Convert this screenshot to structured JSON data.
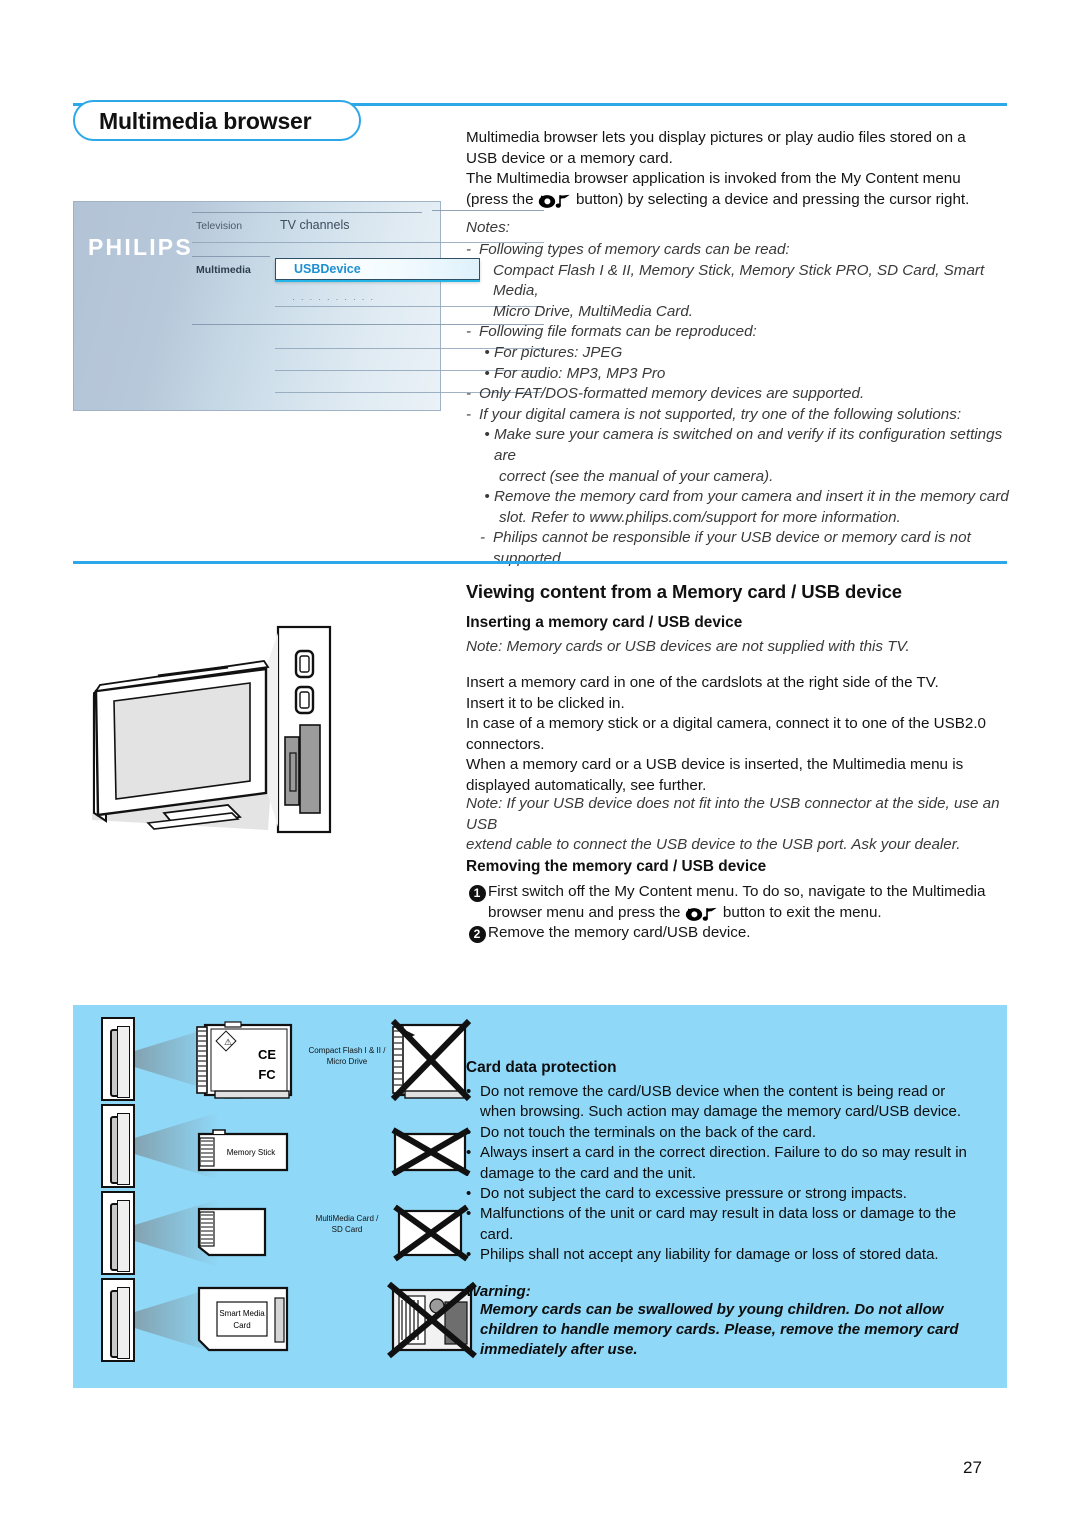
{
  "page": {
    "number": "27"
  },
  "title": {
    "text": "Multimedia browser"
  },
  "colors": {
    "accent": "#2CA8E8",
    "panel": "#8FD8F8",
    "menu_highlight": "#1e8fd0"
  },
  "tv_menu": {
    "brand": "PHILIPS",
    "col_left": [
      "Television",
      "Multimedia"
    ],
    "col_right_top": "TV channels",
    "selected_item": "USBDevice",
    "placeholder_dots": "· · · · · · · · · ·"
  },
  "intro": {
    "lines": [
      "Multimedia browser lets you display pictures or play audio files stored on a",
      "USB device or a memory card.",
      "The Multimedia browser application is invoked from the My Content menu",
      "(press the ",
      " button) by selecting a device and pressing the cursor right."
    ]
  },
  "notes": {
    "heading": "Notes:",
    "items": [
      {
        "marker": "-",
        "indent": 0,
        "text": "Following types of memory cards can be read:"
      },
      {
        "marker": "",
        "indent": 1,
        "text": "Compact Flash I & II, Memory Stick, Memory Stick PRO, SD Card, Smart Media,"
      },
      {
        "marker": "",
        "indent": 1,
        "text": "Micro Drive, MultiMedia Card."
      },
      {
        "marker": "-",
        "indent": 0,
        "text": "Following file formats can be reproduced:"
      },
      {
        "marker": "•",
        "indent": 1,
        "text": "For pictures: JPEG"
      },
      {
        "marker": "•",
        "indent": 1,
        "text": "For audio: MP3, MP3 Pro"
      },
      {
        "marker": "-",
        "indent": 0,
        "text": "Only FAT/DOS-formatted memory devices are supported."
      },
      {
        "marker": "-",
        "indent": 0,
        "text": "If your digital camera is not supported, try one of the following solutions:"
      },
      {
        "marker": "•",
        "indent": 1,
        "text": "Make sure your camera is switched on and verify if its configuration settings are"
      },
      {
        "marker": "",
        "indent": 2,
        "text": "correct (see the manual of your camera)."
      },
      {
        "marker": "•",
        "indent": 1,
        "text": "Remove the memory card from your camera and insert it in the memory card"
      },
      {
        "marker": "",
        "indent": 2,
        "text": "slot. Refer to www.philips.com/support for more information."
      },
      {
        "marker": "-",
        "indent": 1,
        "text": "Philips cannot be responsible if your USB device or memory card is not supported."
      }
    ]
  },
  "section": {
    "heading": "Viewing content from a Memory card / USB device",
    "sub_insert": "Inserting a memory card / USB device",
    "note_supply": "Note: Memory cards or USB devices are not supplied with this TV.",
    "insert_body": [
      "Insert a memory card in one of the cardslots at the right side of the TV.",
      "Insert it to be clicked in.",
      "In case of a memory stick or a digital camera, connect it to one of the USB2.0",
      "connectors.",
      "When a memory card or a USB device is inserted, the Multimedia menu is",
      "displayed automatically, see further."
    ],
    "note_usb": [
      "Note: If your USB device does not fit into the USB connector at the side, use an USB",
      "extend cable to connect the USB device to the USB port. Ask your dealer."
    ],
    "sub_remove": "Removing the memory card / USB device",
    "steps": [
      {
        "num": "1",
        "pre": "First switch off the My Content menu. To do so, navigate to the Multimedia",
        "line2a": "browser menu and press the ",
        "line2b": " button to exit the menu."
      },
      {
        "num": "2",
        "pre": "Remove the memory card/USB device.",
        "line2a": "",
        "line2b": ""
      }
    ]
  },
  "card_panel": {
    "heading": "Card data protection",
    "bullets": [
      [
        "Do not remove the card/USB device when the content is being read or",
        "when browsing. Such action may damage the memory card/USB device."
      ],
      [
        "Do not touch the terminals on the back of the card."
      ],
      [
        "Always insert a card in the correct direction. Failure to do so may result in",
        "damage to the card and the unit."
      ],
      [
        "Do not subject the card to excessive pressure or strong impacts."
      ],
      [
        "Malfunctions of the unit or card may result in data loss or damage to the",
        "card."
      ],
      [
        "Philips shall not accept any liability for damage or loss of stored data."
      ]
    ],
    "warning_heading": "Warning:",
    "warning_body": [
      "Memory cards can be swallowed by young children. Do not allow",
      "children to handle memory cards. Please, remove the memory card",
      "immediately after use."
    ],
    "card_labels": [
      {
        "l1": "Compact Flash I & II /",
        "l2": "Micro Drive"
      },
      {
        "l1": "Memory Stick",
        "l2": ""
      },
      {
        "l1": "MultiMedia Card /",
        "l2": "SD Card"
      },
      {
        "l1": "Smart Media",
        "l2": "Card"
      }
    ]
  }
}
